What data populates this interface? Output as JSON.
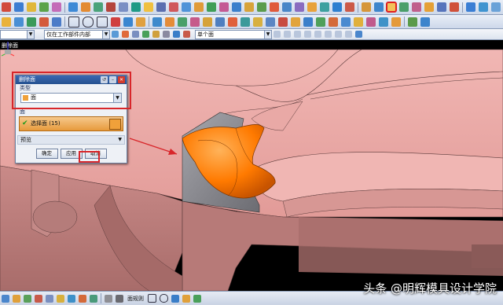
{
  "app": {
    "viewport_title": "删除面"
  },
  "toolbar2": {
    "filter_combo": "",
    "assembly_combo": "仅在工作部件内部",
    "selection_combo": "单个面"
  },
  "dialog": {
    "title": "删除面",
    "type_group": "类型",
    "type_value": "面",
    "face_group": "面",
    "face_select": "选择面 (15)",
    "preview_group": "预览",
    "ok": "确定",
    "apply": "应用",
    "cancel": "取消"
  },
  "statusbar": {
    "label": "面规则 "
  },
  "watermark": "头条 @明辉模具设计学院",
  "colors": {
    "part": "#e8a8a6",
    "selected": "#ff7a00",
    "highlight": "#d8262a"
  }
}
